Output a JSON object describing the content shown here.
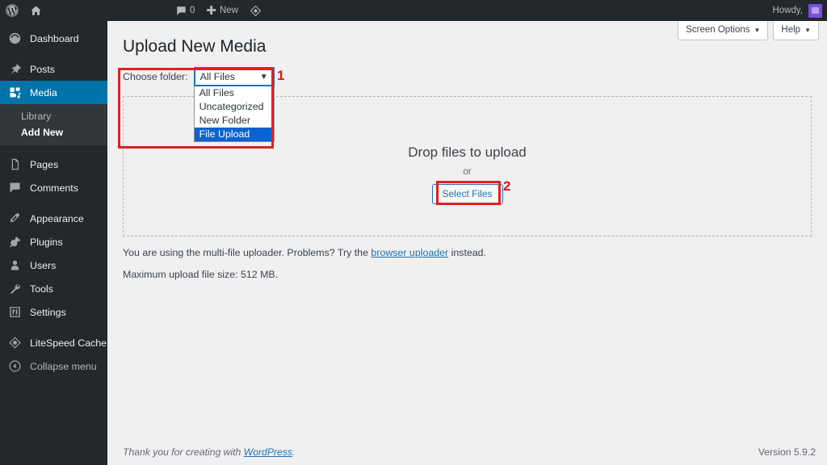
{
  "adminbar": {
    "wp_logo_icon": "wordpress-logo-icon",
    "site_home_icon": "home-icon",
    "comments_icon": "comment-bubble-icon",
    "comments_count": "0",
    "new_icon": "plus-icon",
    "new_label": "New",
    "litespeed_icon": "litespeed-diamond-icon",
    "howdy": "Howdy,",
    "avatar_icon": "user-avatar",
    "avatar_color": "#7b4fd8"
  },
  "sidebar": {
    "items": [
      {
        "label": "Dashboard",
        "icon": "dashboard-icon",
        "current": false
      },
      {
        "label": "Posts",
        "icon": "pin-icon",
        "current": false
      },
      {
        "label": "Media",
        "icon": "media-icon",
        "current": true
      },
      {
        "label": "Pages",
        "icon": "pages-icon",
        "current": false
      },
      {
        "label": "Comments",
        "icon": "comment-icon",
        "current": false
      },
      {
        "label": "Appearance",
        "icon": "appearance-brush-icon",
        "current": false
      },
      {
        "label": "Plugins",
        "icon": "plugins-plug-icon",
        "current": false
      },
      {
        "label": "Users",
        "icon": "users-icon",
        "current": false
      },
      {
        "label": "Tools",
        "icon": "tools-wrench-icon",
        "current": false
      },
      {
        "label": "Settings",
        "icon": "settings-icon",
        "current": false
      },
      {
        "label": "LiteSpeed Cache",
        "icon": "litespeed-diamond-icon",
        "current": false
      }
    ],
    "media_submenu": [
      {
        "label": "Library",
        "current": false
      },
      {
        "label": "Add New",
        "current": true
      }
    ],
    "collapse": {
      "label": "Collapse menu",
      "icon": "collapse-arrow-icon"
    },
    "current_color": "#0073aa"
  },
  "screen_meta": {
    "screen_options_label": "Screen Options",
    "help_label": "Help",
    "caret_icon": "chevron-down-icon"
  },
  "main": {
    "page_title": "Upload New Media",
    "folder": {
      "label": "Choose folder:",
      "selected": "All Files",
      "caret_icon": "chevron-down-icon",
      "options": [
        {
          "label": "All Files",
          "selected": false
        },
        {
          "label": "Uncategorized",
          "selected": false
        },
        {
          "label": "New Folder",
          "selected": false
        },
        {
          "label": "File Upload",
          "selected": true
        }
      ],
      "highlight_color": "#0b63ce"
    },
    "dropzone": {
      "title": "Drop files to upload",
      "or": "or",
      "select_files_label": "Select Files"
    },
    "uploader_note_before": "You are using the multi-file uploader. Problems? Try the ",
    "uploader_note_link": "browser uploader",
    "uploader_note_after": " instead.",
    "max_upload": "Maximum upload file size: 512 MB."
  },
  "footer": {
    "thanks_before": "Thank you for creating with ",
    "thanks_link": "WordPress",
    "thanks_after": ".",
    "version": "Version 5.9.2"
  },
  "annotations": {
    "marker_1": "1",
    "marker_2": "2",
    "color": "#e02020"
  }
}
